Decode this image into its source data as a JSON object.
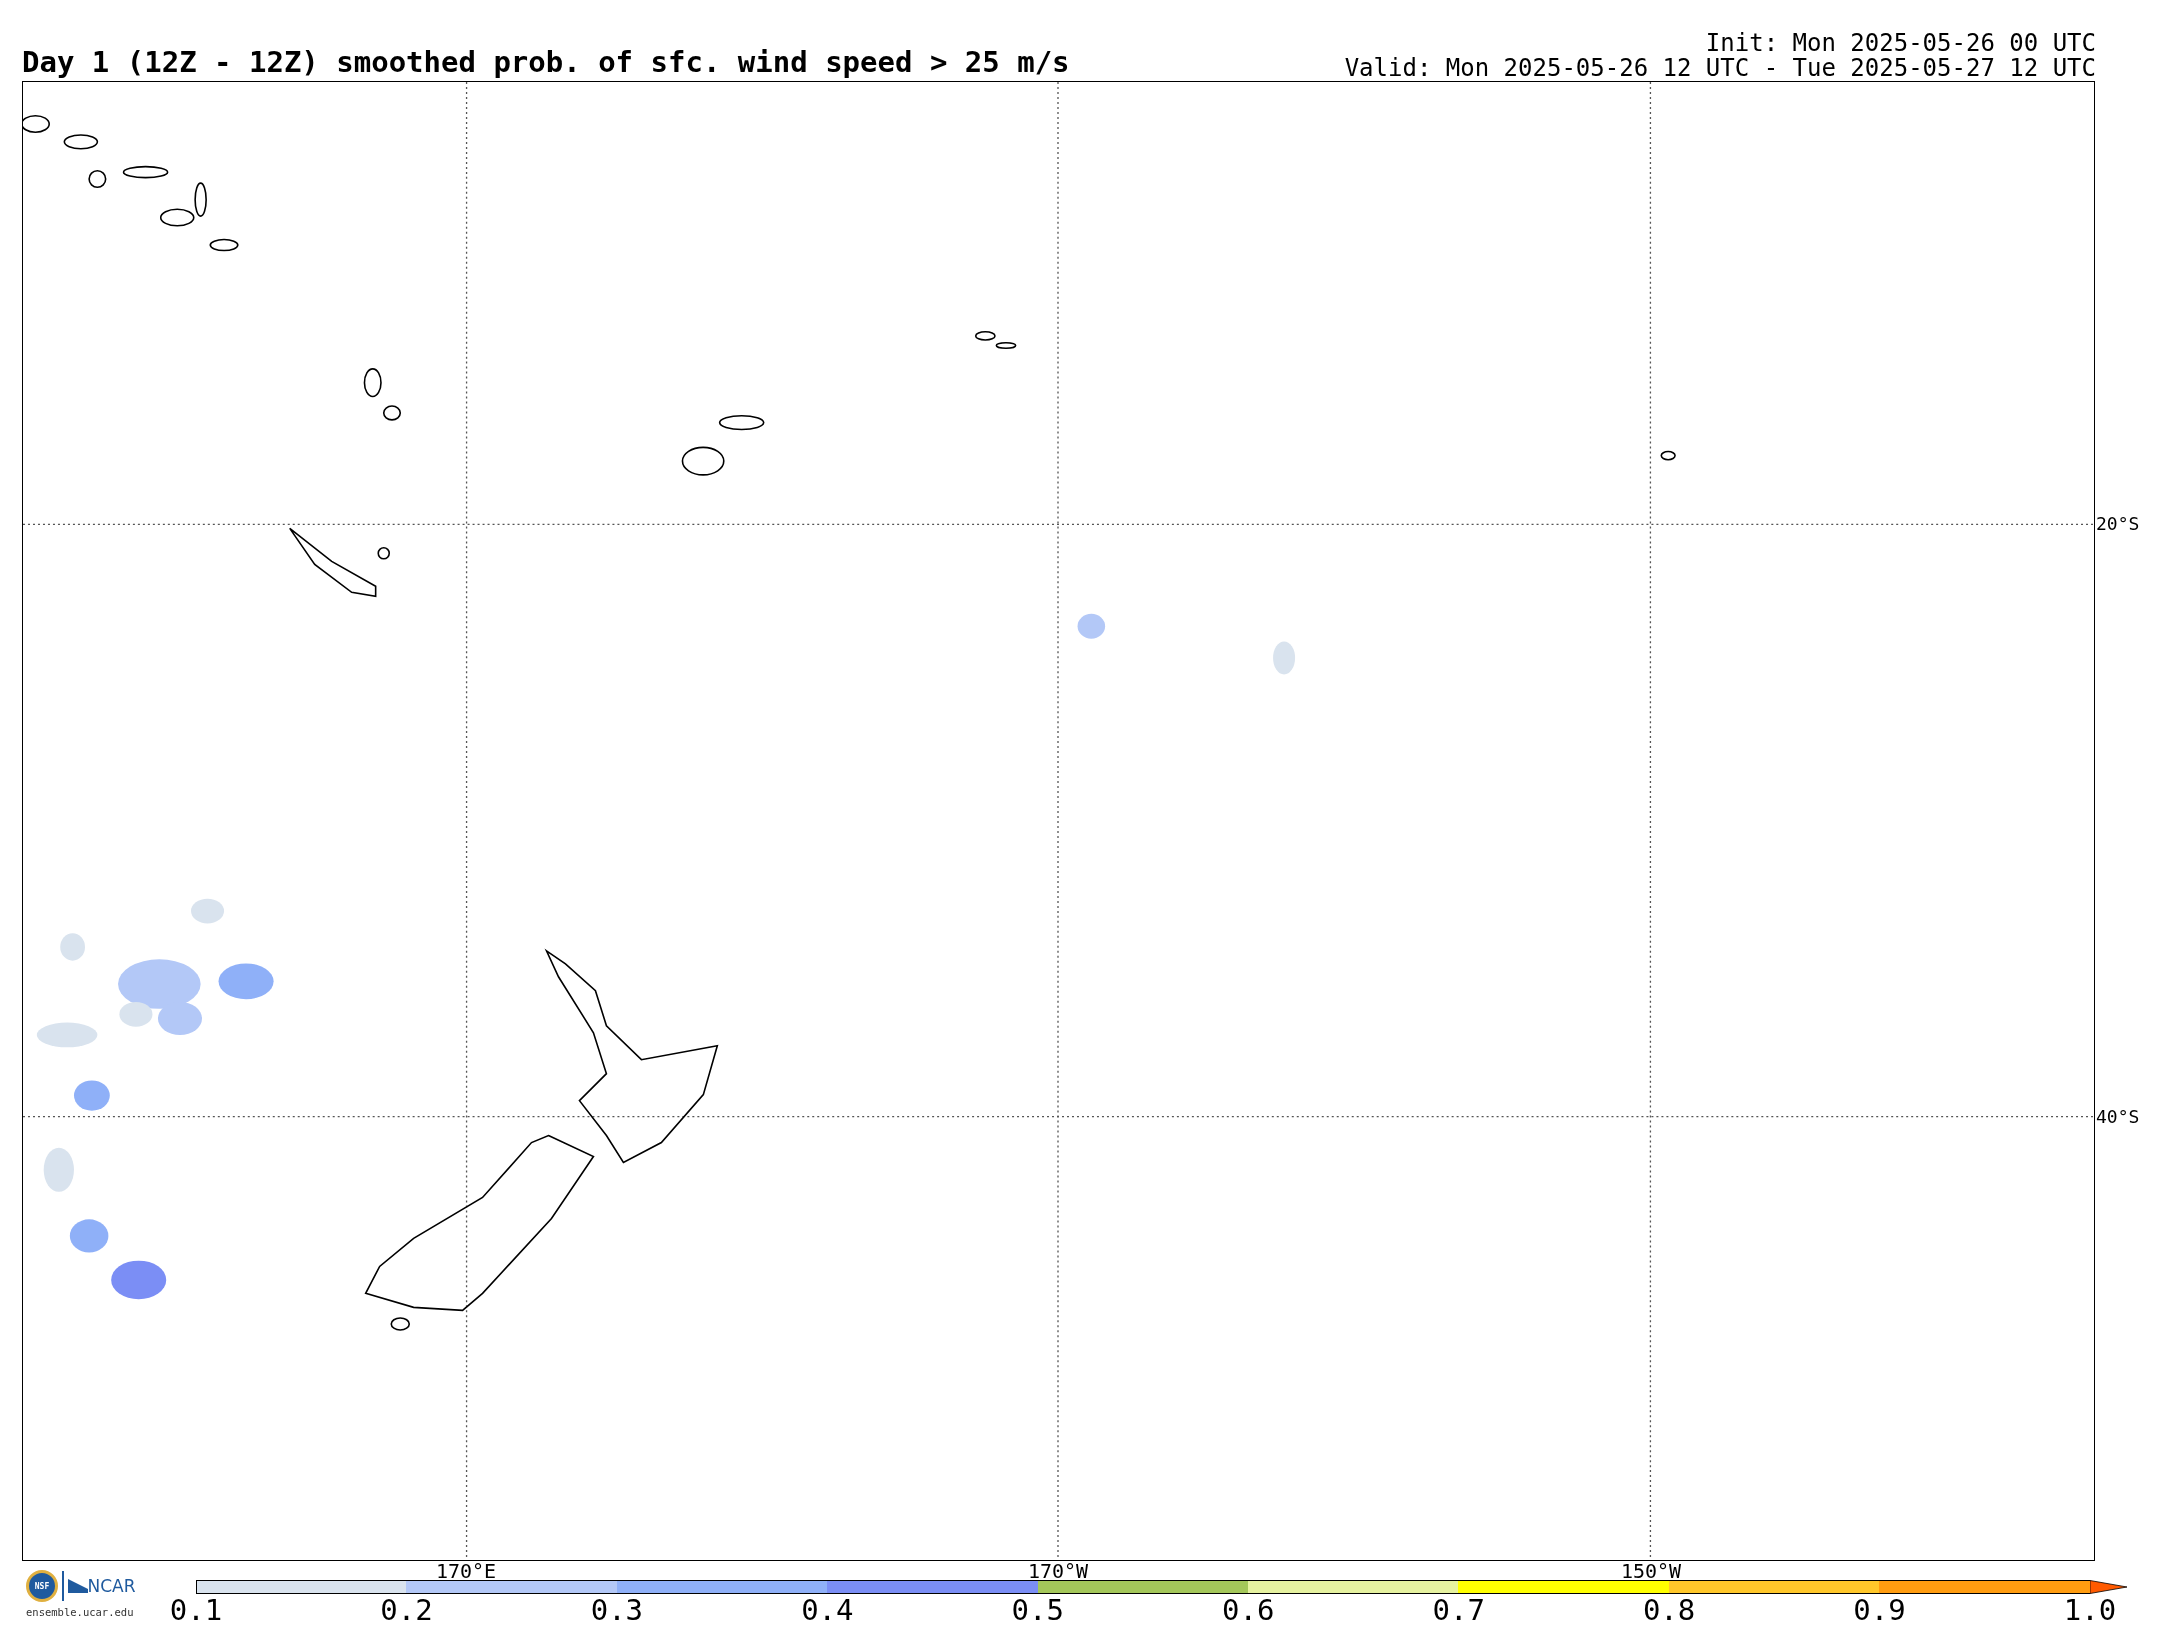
{
  "title": "Day 1 (12Z - 12Z) smoothed prob. of sfc. wind speed > 25 m/s",
  "init": "Init: Mon 2025-05-26 00 UTC",
  "valid": "Valid: Mon 2025-05-26 12 UTC - Tue 2025-05-27 12 UTC",
  "lat_labels": [
    "20°S",
    "40°S"
  ],
  "lon_labels": [
    "170°E",
    "170°W",
    "150°W"
  ],
  "logo": {
    "nsf": "NSF",
    "ncar": "NCAR",
    "url": "ensemble.ucar.edu"
  },
  "colorbar": {
    "bins": [
      {
        "kind": "bar",
        "color": "#d9e3ee"
      },
      {
        "kind": "bar",
        "color": "#b3c8f7"
      },
      {
        "kind": "bar",
        "color": "#8fb0f8"
      },
      {
        "kind": "bar",
        "color": "#7b8ef5"
      },
      {
        "kind": "bar",
        "color": "#a4c75a"
      },
      {
        "kind": "bar",
        "color": "#e6f2a0"
      },
      {
        "kind": "bar",
        "color": "#ffff00"
      },
      {
        "kind": "bar",
        "color": "#ffc72a"
      },
      {
        "kind": "bar",
        "color": "#ff9c10"
      },
      {
        "kind": "arrow",
        "color": "#ff5a00"
      }
    ],
    "ticks": [
      "0.1",
      "0.2",
      "0.3",
      "0.4",
      "0.5",
      "0.6",
      "0.7",
      "0.8",
      "0.9",
      "1.0"
    ]
  }
}
